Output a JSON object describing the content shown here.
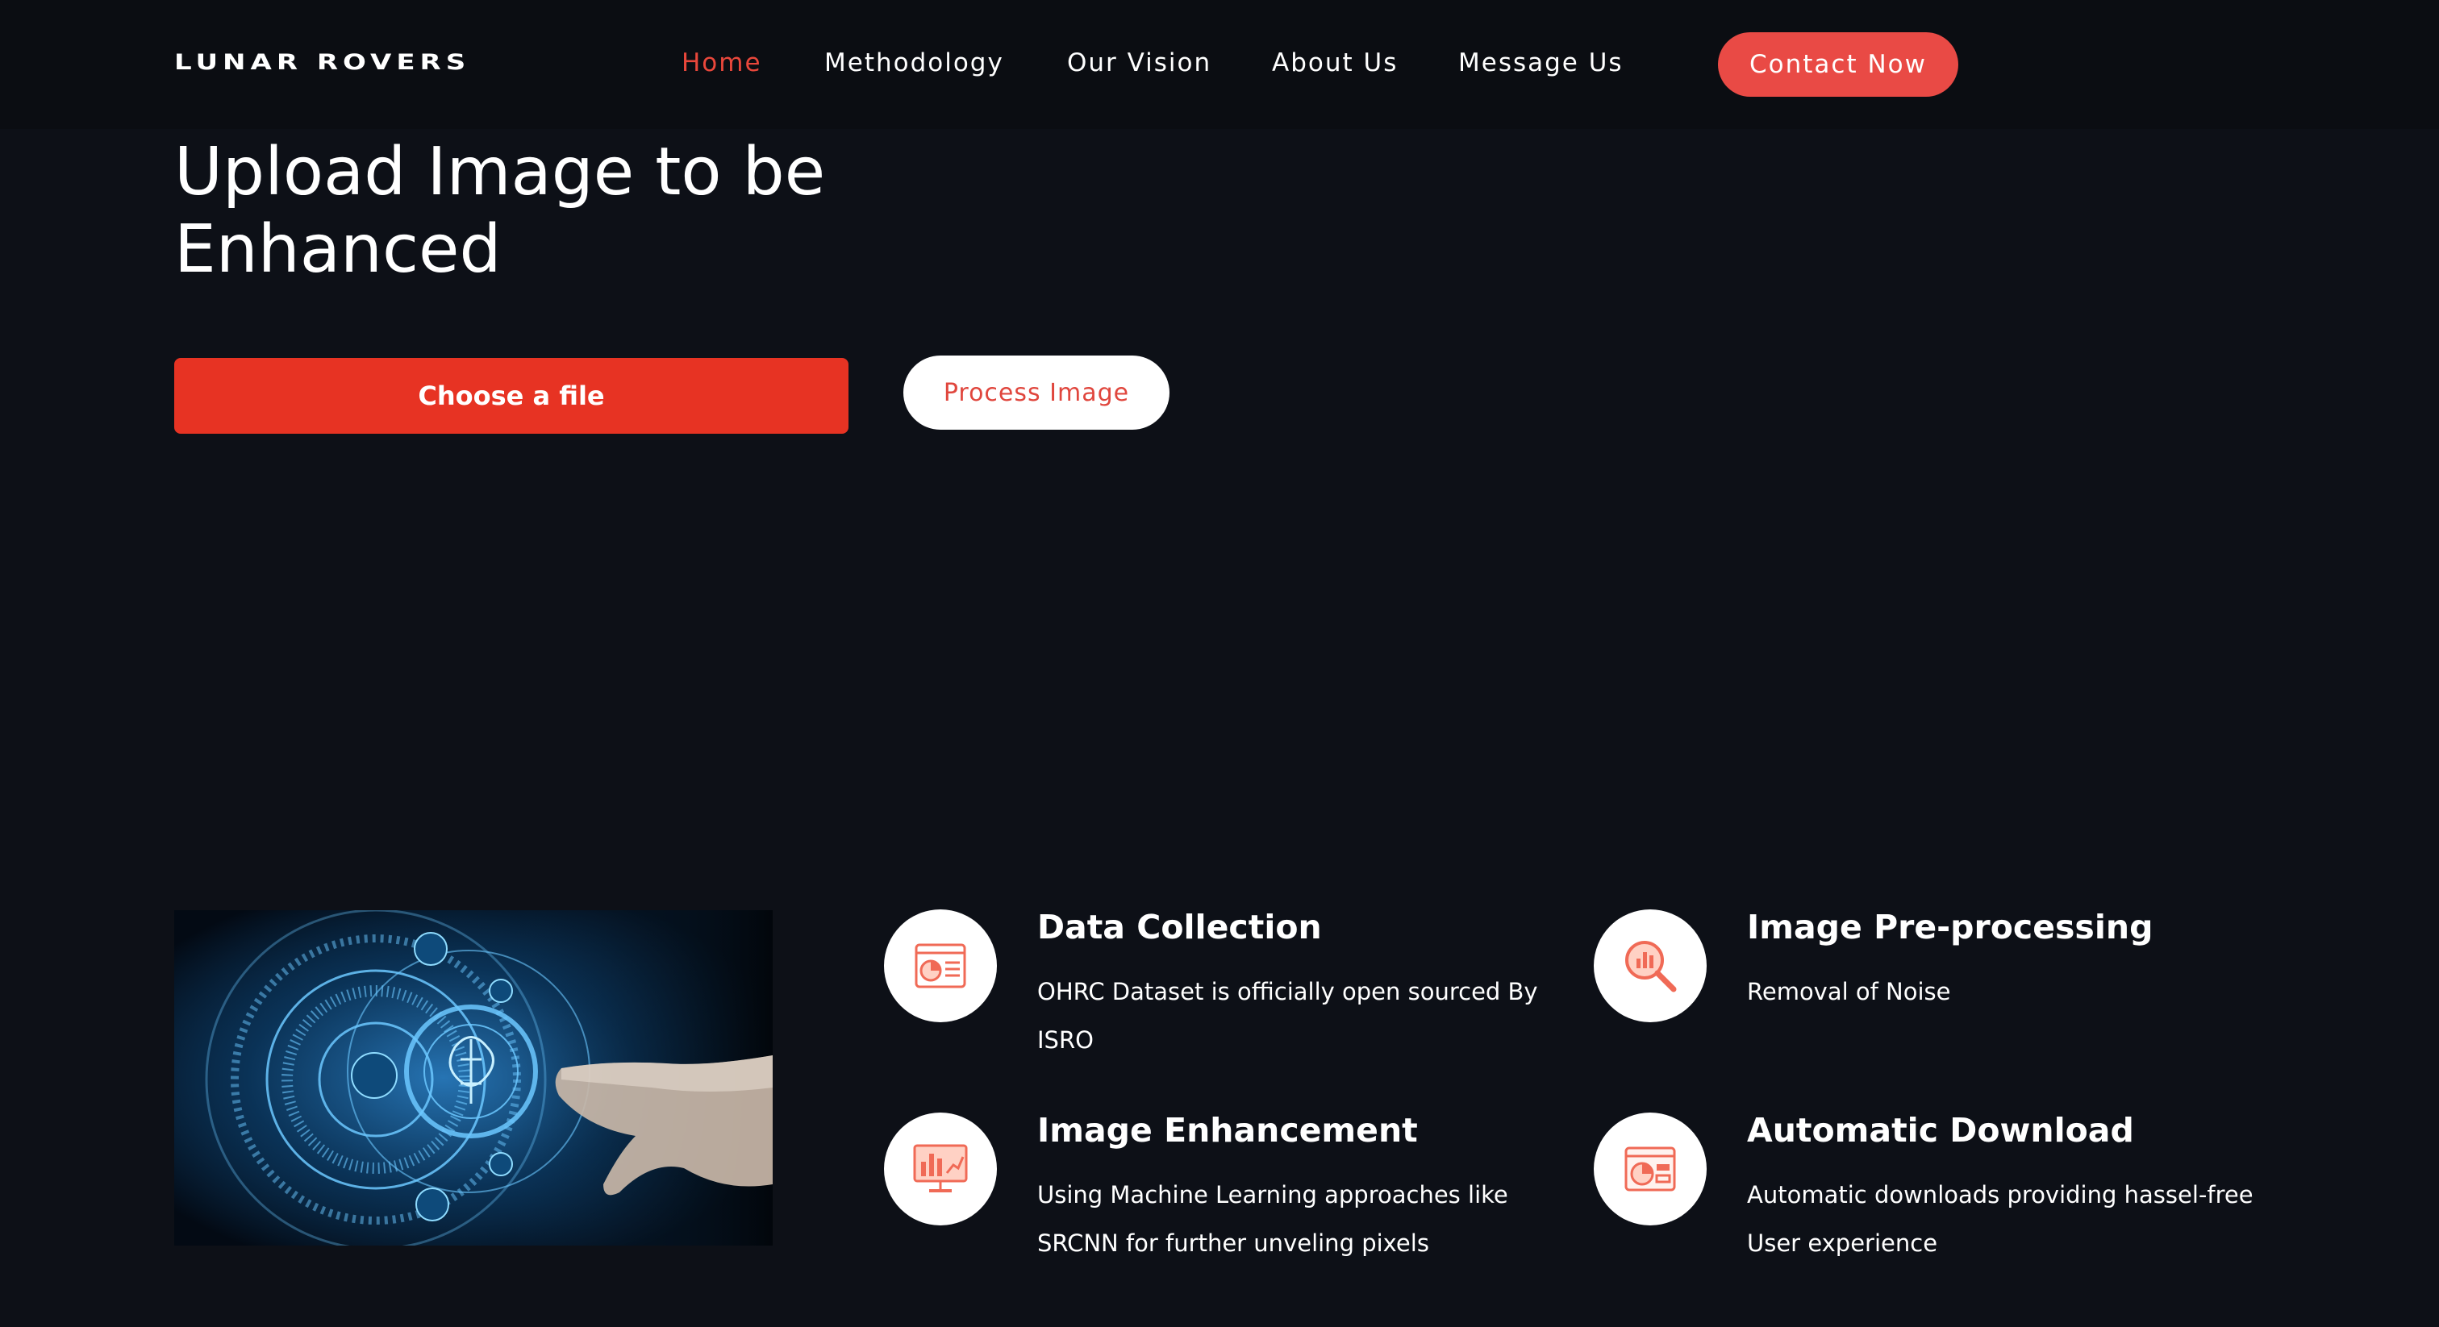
{
  "header": {
    "logo": "LUNAR ROVERS",
    "nav": [
      {
        "label": "Home"
      },
      {
        "label": "Methodology"
      },
      {
        "label": "Our Vision"
      },
      {
        "label": "About Us"
      },
      {
        "label": "Message Us"
      }
    ],
    "contact_label": "Contact Now"
  },
  "upload": {
    "heading_line1": "Upload Image to be",
    "heading_line2": "Enhanced",
    "choose_label": "Choose a file",
    "process_label": "Process Image"
  },
  "features": [
    {
      "title": "Data Collection",
      "description": "OHRC Dataset is officially open sourced By ISRO",
      "icon": "dashboard-chart-icon"
    },
    {
      "title": "Image Pre-processing",
      "description": "Removal of Noise",
      "icon": "magnifier-chart-icon"
    },
    {
      "title": "Image Enhancement",
      "description": "Using Machine Learning approaches like SRCNN for further unveling pixels",
      "icon": "monitor-analytics-icon"
    },
    {
      "title": "Automatic Download",
      "description": "Automatic downloads providing hassel-free User experience",
      "icon": "report-pie-icon"
    }
  ],
  "colors": {
    "background": "#0d1017",
    "accent": "#e94a45",
    "active_nav": "#e9473b"
  }
}
